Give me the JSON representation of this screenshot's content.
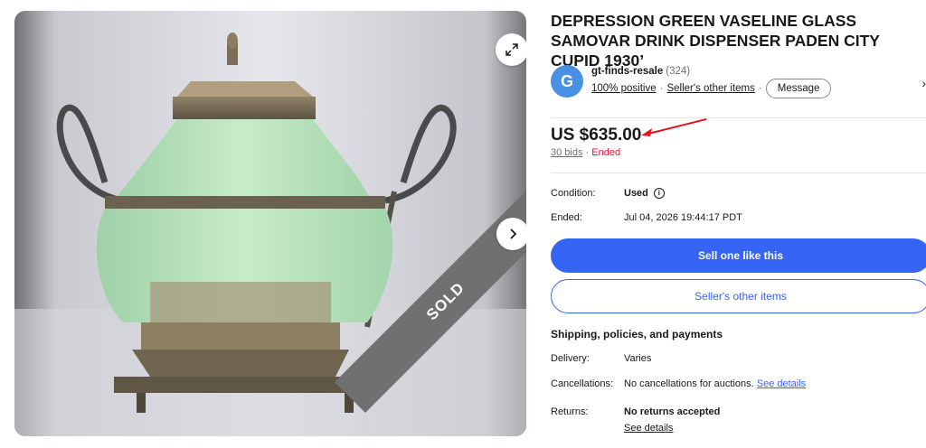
{
  "gallery": {
    "sold_label": "SOLD",
    "icons": {
      "expand": "expand-icon",
      "next": "chevron-right-icon"
    }
  },
  "listing": {
    "title": "DEPRESSION GREEN VASELINE GLASS SAMOVAR DRINK DISPENSER PADEN CITY CUPID 1930’"
  },
  "seller": {
    "avatar_letter": "G",
    "name": "gt-finds-resale",
    "feedback_count": "(324)",
    "positive": "100% positive",
    "other_items_link": "Seller's other items",
    "message_button": "Message",
    "chevron": "›"
  },
  "price": {
    "amount": "US $635.00",
    "bids": "30 bids",
    "separator": " · ",
    "status": "Ended"
  },
  "details": {
    "condition_label": "Condition:",
    "condition_value": "Used",
    "ended_label": "Ended:",
    "ended_value": "Jul 04, 2026 19:44:17 PDT"
  },
  "actions": {
    "sell_one": "Sell one like this",
    "seller_other_items": "Seller's other items"
  },
  "shipping": {
    "section_title": "Shipping, policies, and payments",
    "delivery_label": "Delivery:",
    "delivery_value": "Varies",
    "cancellations_label": "Cancellations:",
    "cancellations_value": "No cancellations for auctions.",
    "see_details": "See details",
    "returns_label": "Returns:",
    "returns_value": "No returns accepted",
    "returns_see_details": "See details"
  },
  "colors": {
    "accent": "#3665f3",
    "ended": "#e0103a",
    "arrow": "#e8141c"
  }
}
